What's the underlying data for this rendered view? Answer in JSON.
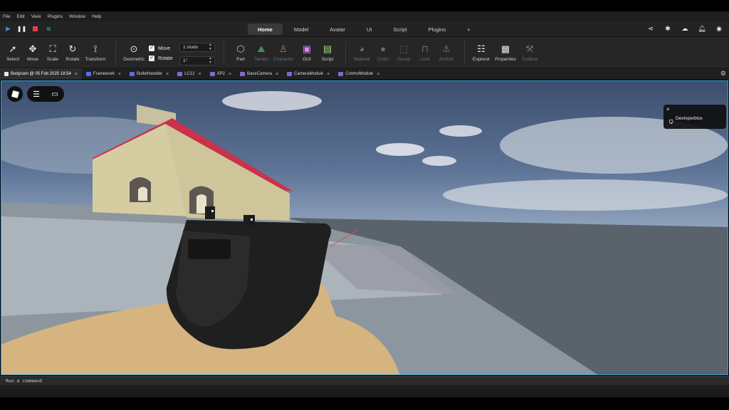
{
  "menu": [
    "File",
    "Edit",
    "View",
    "Plugins",
    "Window",
    "Help"
  ],
  "run_controls": {
    "play_icon": "play-icon",
    "pause_icon": "pause-icon",
    "stop_icon": "stop-icon",
    "client_icon": "client-server-icon"
  },
  "ribbon_tabs": [
    "Home",
    "Model",
    "Avatar",
    "UI",
    "Script",
    "Plugins",
    "+"
  ],
  "active_ribbon_tab": "Home",
  "top_right_icons": [
    "share-icon",
    "collaborate-icon",
    "cloud-icon",
    "notifications-icon",
    "account-icon"
  ],
  "tools": {
    "select": "Select",
    "move": "Move",
    "scale": "Scale",
    "rotate": "Rotate",
    "transform": "Transform",
    "geometric": "Geometric",
    "part": "Part",
    "terrain": "Terrain",
    "character": "Character",
    "gui": "GUI",
    "script": "Script",
    "material": "Material",
    "color": "Color",
    "group": "Group",
    "lock": "Lock",
    "anchor": "Anchor",
    "explorer": "Explorer",
    "properties": "Properties",
    "toolbox": "Toolbox"
  },
  "snapping": {
    "move_label": "Move",
    "rotate_label": "Rotate",
    "move_value": "1 studs",
    "rotate_value": "1°",
    "move_checked": true,
    "rotate_checked": true
  },
  "doc_tabs": [
    {
      "label": "Bodycam @ 05 Feb 2025 18:54",
      "active": true
    },
    {
      "label": "Framework"
    },
    {
      "label": "BulletHandler"
    },
    {
      "label": "LC12"
    },
    {
      "label": "XP2"
    },
    {
      "label": "BaseCamera"
    },
    {
      "label": "CameraModule"
    },
    {
      "label": "ControlModule",
      "italic": true
    }
  ],
  "viewport": {
    "player_name": "Devloperblox",
    "accent_color": "#3aa0d8",
    "roof_color": "#c8334a",
    "wall_color": "#d6cca2"
  },
  "command_bar": {
    "placeholder": "Run a command"
  }
}
